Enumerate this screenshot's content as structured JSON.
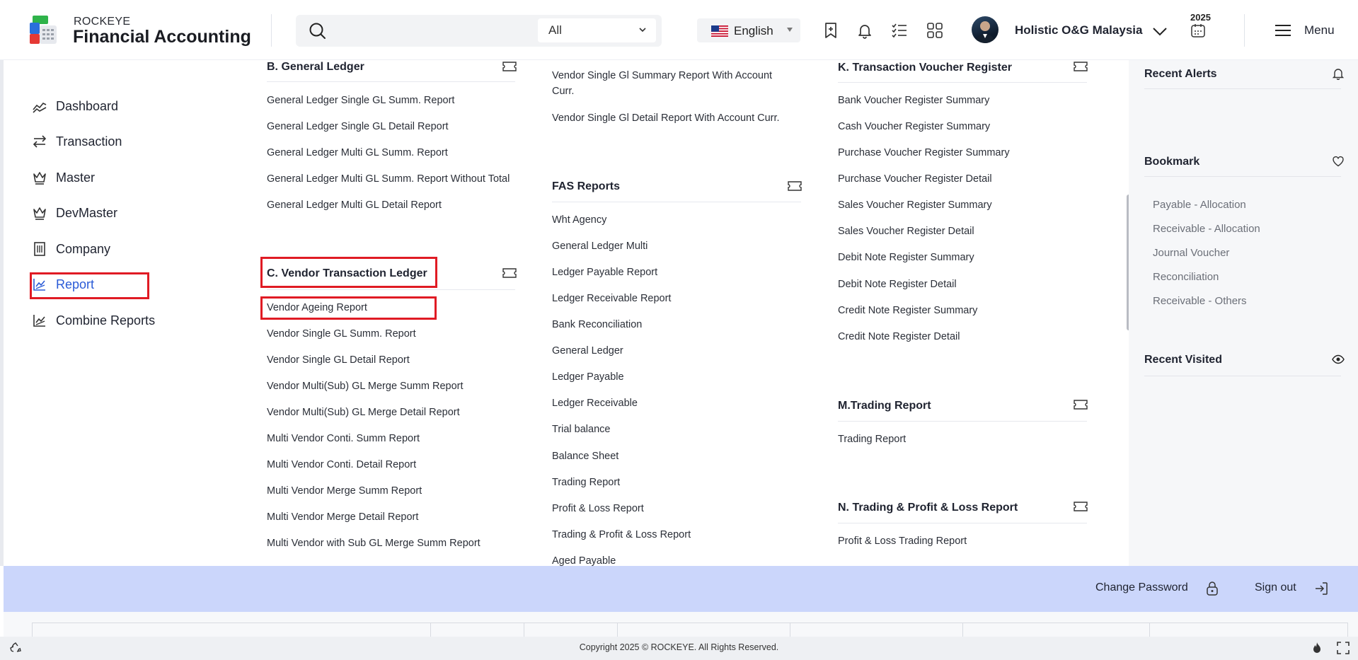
{
  "brand": {
    "small": "ROCKEYE",
    "big": "Financial Accounting"
  },
  "search": {
    "placeholder": "",
    "filter_value": "All"
  },
  "language": "English",
  "user": {
    "company": "Holistic O&G Malaysia",
    "year": "2025"
  },
  "menu_label": "Menu",
  "sidebar": {
    "items": [
      {
        "label": "Dashboard",
        "icon": "chart-line-icon"
      },
      {
        "label": "Transaction",
        "icon": "arrows-swap-icon"
      },
      {
        "label": "Master",
        "icon": "crown-icon"
      },
      {
        "label": "DevMaster",
        "icon": "crown-icon"
      },
      {
        "label": "Company",
        "icon": "building-icon"
      },
      {
        "label": "Report",
        "icon": "report-chart-icon",
        "active": true
      },
      {
        "label": "Combine Reports",
        "icon": "report-chart-icon"
      }
    ]
  },
  "col1": {
    "general_ledger": {
      "title": "B. General Ledger",
      "items": [
        "General Ledger Single GL Summ. Report",
        "General Ledger Single GL Detail Report",
        "General Ledger Multi GL Summ. Report",
        "General Ledger Multi GL Summ. Report Without Total",
        "General Ledger Multi GL Detail Report"
      ]
    },
    "vendor_ledger": {
      "title": "C. Vendor Transaction Ledger",
      "items": [
        "Vendor Ageing Report",
        "Vendor Single GL Summ. Report",
        "Vendor Single GL Detail Report",
        "Vendor Multi(Sub) GL Merge Summ Report",
        "Vendor Multi(Sub) GL Merge Detail Report",
        "Multi Vendor Conti. Summ Report",
        "Multi Vendor Conti. Detail Report",
        "Multi Vendor Merge Summ Report",
        "Multi Vendor Merge Detail Report",
        "Multi Vendor with Sub GL Merge Summ Report"
      ]
    }
  },
  "col2": {
    "top_items": [
      "Vendor Single Gl Summary Report With Account Curr.",
      "Vendor Single Gl Detail Report With Account Curr."
    ],
    "fas": {
      "title": "FAS Reports",
      "items": [
        "Wht Agency",
        "General Ledger Multi",
        "Ledger Payable Report",
        "Ledger Receivable Report",
        "Bank Reconciliation",
        "General Ledger",
        "Ledger Payable",
        "Ledger Receivable",
        "Trial balance",
        "Balance Sheet",
        "Trading Report",
        "Profit & Loss Report",
        "Trading & Profit & Loss Report",
        "Aged Payable"
      ]
    }
  },
  "col3": {
    "voucher": {
      "title": "K. Transaction Voucher Register",
      "items": [
        "Bank Voucher Register Summary",
        "Cash Voucher Register Summary",
        "Purchase Voucher Register Summary",
        "Purchase Voucher Register Detail",
        "Sales Voucher Register Summary",
        "Sales Voucher Register Detail",
        "Debit Note Register Summary",
        "Debit Note Register Detail",
        "Credit Note Register Summary",
        "Credit Note Register Detail"
      ]
    },
    "trading": {
      "title": "M.Trading Report",
      "items": [
        "Trading Report"
      ]
    },
    "trading_pl": {
      "title": "N. Trading & Profit & Loss Report",
      "items": [
        "Profit & Loss Trading Report"
      ]
    }
  },
  "right_panel": {
    "alerts_title": "Recent Alerts",
    "bookmark_title": "Bookmark",
    "bookmarks": [
      "Payable - Allocation",
      "Receivable - Allocation",
      "Journal Voucher",
      "Reconciliation",
      "Receivable - Others"
    ],
    "visited_title": "Recent Visited"
  },
  "bottom": {
    "change_password": "Change Password",
    "sign_out": "Sign out"
  },
  "footer": "Copyright 2025 © ROCKEYE. All Rights Reserved.",
  "colors": {
    "accent": "#2a5bd7",
    "highlight": "#e01b24",
    "bottom_bar": "#cbd6fb"
  }
}
